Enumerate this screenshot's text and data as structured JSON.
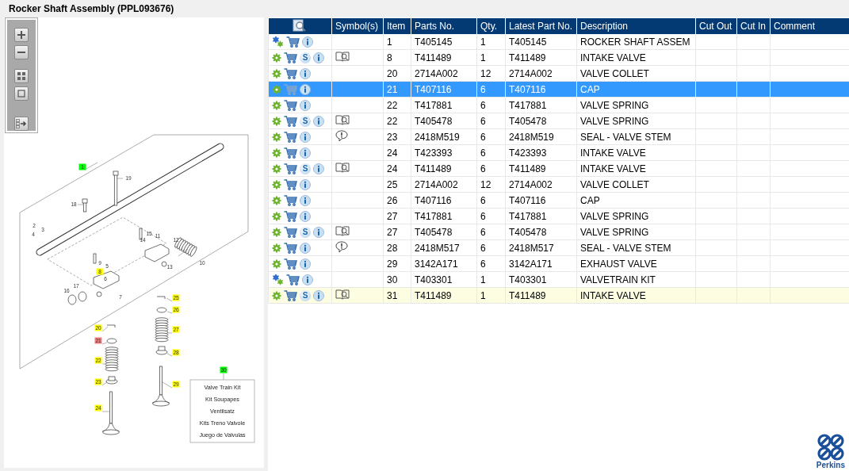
{
  "title": "Rocker Shaft Assembly (PPL093676)",
  "toolbar": [
    {
      "kind": "zoom-in"
    },
    {
      "kind": "zoom-out"
    },
    {
      "kind": "fit"
    },
    {
      "kind": "actual"
    },
    {
      "kind": "exit"
    }
  ],
  "callouts": [
    {
      "label": "1",
      "color": "#00ff00"
    },
    {
      "label": "19"
    },
    {
      "label": "18"
    },
    {
      "label": "2"
    },
    {
      "label": "3"
    },
    {
      "label": "4"
    },
    {
      "label": "15"
    },
    {
      "label": "11"
    },
    {
      "label": "14"
    },
    {
      "label": "12"
    },
    {
      "label": "10"
    },
    {
      "label": "9"
    },
    {
      "label": "5"
    },
    {
      "label": "8",
      "color": "#ffff00"
    },
    {
      "label": "6"
    },
    {
      "label": "17"
    },
    {
      "label": "16"
    },
    {
      "label": "7"
    },
    {
      "label": "13"
    },
    {
      "label": "25",
      "color": "#ffff00"
    },
    {
      "label": "26",
      "color": "#ffff00"
    },
    {
      "label": "27",
      "color": "#ffff00"
    },
    {
      "label": "28",
      "color": "#ffff00"
    },
    {
      "label": "20",
      "color": "#ffff00"
    },
    {
      "label": "21",
      "color": "#f08080"
    },
    {
      "label": "22",
      "color": "#ffff00"
    },
    {
      "label": "23",
      "color": "#ffff00"
    },
    {
      "label": "24",
      "color": "#ffff00"
    },
    {
      "label": "29",
      "color": "#ffff00"
    },
    {
      "label": "30",
      "color": "#00ff00"
    }
  ],
  "kit_legend": [
    "Valve Train Kit",
    "Kit Soupapes",
    "Ventilsatz",
    "Kits Treno Valvole",
    "Juego de Valvulas"
  ],
  "table": {
    "columns": [
      "Symbol(s)",
      "Item",
      "Parts No.",
      "Qty.",
      "Latest Part No.",
      "Description",
      "Cut Out",
      "Cut In",
      "Comment"
    ],
    "rows": [
      {
        "kind": "gears",
        "status": null,
        "symbol": null,
        "selected": false,
        "highlighted": false,
        "item": "1",
        "parts_no": "T405145",
        "qty": "1",
        "latest_part_no": "T405145",
        "description": "ROCKER SHAFT ASSEM"
      },
      {
        "kind": "gear",
        "status": "S",
        "symbol": {
          "kind": "manual"
        },
        "selected": false,
        "highlighted": false,
        "item": "8",
        "parts_no": "T411489",
        "qty": "1",
        "latest_part_no": "T411489",
        "description": "INTAKE VALVE"
      },
      {
        "kind": "gear",
        "status": null,
        "symbol": null,
        "selected": false,
        "highlighted": false,
        "item": "20",
        "parts_no": "2714A002",
        "qty": "12",
        "latest_part_no": "2714A002",
        "description": "VALVE COLLET"
      },
      {
        "kind": "gear",
        "status": null,
        "symbol": null,
        "selected": true,
        "highlighted": false,
        "item": "21",
        "parts_no": "T407116",
        "qty": "6",
        "latest_part_no": "T407116",
        "description": "CAP"
      },
      {
        "kind": "gear",
        "status": null,
        "symbol": null,
        "selected": false,
        "highlighted": false,
        "item": "22",
        "parts_no": "T417881",
        "qty": "6",
        "latest_part_no": "T417881",
        "description": "VALVE SPRING"
      },
      {
        "kind": "gear",
        "status": "S",
        "symbol": {
          "kind": "manual"
        },
        "selected": false,
        "highlighted": false,
        "item": "22",
        "parts_no": "T405478",
        "qty": "6",
        "latest_part_no": "T405478",
        "description": "VALVE SPRING"
      },
      {
        "kind": "gear",
        "status": null,
        "symbol": {
          "kind": "note"
        },
        "selected": false,
        "highlighted": false,
        "item": "23",
        "parts_no": "2418M519",
        "qty": "6",
        "latest_part_no": "2418M519",
        "description": "SEAL - VALVE STEM"
      },
      {
        "kind": "gear",
        "status": null,
        "symbol": null,
        "selected": false,
        "highlighted": false,
        "item": "24",
        "parts_no": "T423393",
        "qty": "6",
        "latest_part_no": "T423393",
        "description": "INTAKE VALVE"
      },
      {
        "kind": "gear",
        "status": "S",
        "symbol": {
          "kind": "manual"
        },
        "selected": false,
        "highlighted": false,
        "item": "24",
        "parts_no": "T411489",
        "qty": "6",
        "latest_part_no": "T411489",
        "description": "INTAKE VALVE"
      },
      {
        "kind": "gear",
        "status": null,
        "symbol": null,
        "selected": false,
        "highlighted": false,
        "item": "25",
        "parts_no": "2714A002",
        "qty": "12",
        "latest_part_no": "2714A002",
        "description": "VALVE COLLET"
      },
      {
        "kind": "gear",
        "status": null,
        "symbol": null,
        "selected": false,
        "highlighted": false,
        "item": "26",
        "parts_no": "T407116",
        "qty": "6",
        "latest_part_no": "T407116",
        "description": "CAP"
      },
      {
        "kind": "gear",
        "status": null,
        "symbol": null,
        "selected": false,
        "highlighted": false,
        "item": "27",
        "parts_no": "T417881",
        "qty": "6",
        "latest_part_no": "T417881",
        "description": "VALVE SPRING"
      },
      {
        "kind": "gear",
        "status": "S",
        "symbol": {
          "kind": "manual"
        },
        "selected": false,
        "highlighted": false,
        "item": "27",
        "parts_no": "T405478",
        "qty": "6",
        "latest_part_no": "T405478",
        "description": "VALVE SPRING"
      },
      {
        "kind": "gear",
        "status": null,
        "symbol": {
          "kind": "note"
        },
        "selected": false,
        "highlighted": false,
        "item": "28",
        "parts_no": "2418M517",
        "qty": "6",
        "latest_part_no": "2418M517",
        "description": "SEAL - VALVE STEM"
      },
      {
        "kind": "gear",
        "status": null,
        "symbol": null,
        "selected": false,
        "highlighted": false,
        "item": "29",
        "parts_no": "3142A171",
        "qty": "6",
        "latest_part_no": "3142A171",
        "description": "EXHAUST VALVE"
      },
      {
        "kind": "gears",
        "status": null,
        "symbol": null,
        "selected": false,
        "highlighted": false,
        "item": "30",
        "parts_no": "T403301",
        "qty": "1",
        "latest_part_no": "T403301",
        "description": "VALVETRAIN KIT"
      },
      {
        "kind": "gear",
        "status": "S",
        "symbol": {
          "kind": "manual"
        },
        "selected": false,
        "highlighted": true,
        "item": "31",
        "parts_no": "T411489",
        "qty": "1",
        "latest_part_no": "T411489",
        "description": "INTAKE VALVE"
      }
    ]
  },
  "brand": "Perkins"
}
